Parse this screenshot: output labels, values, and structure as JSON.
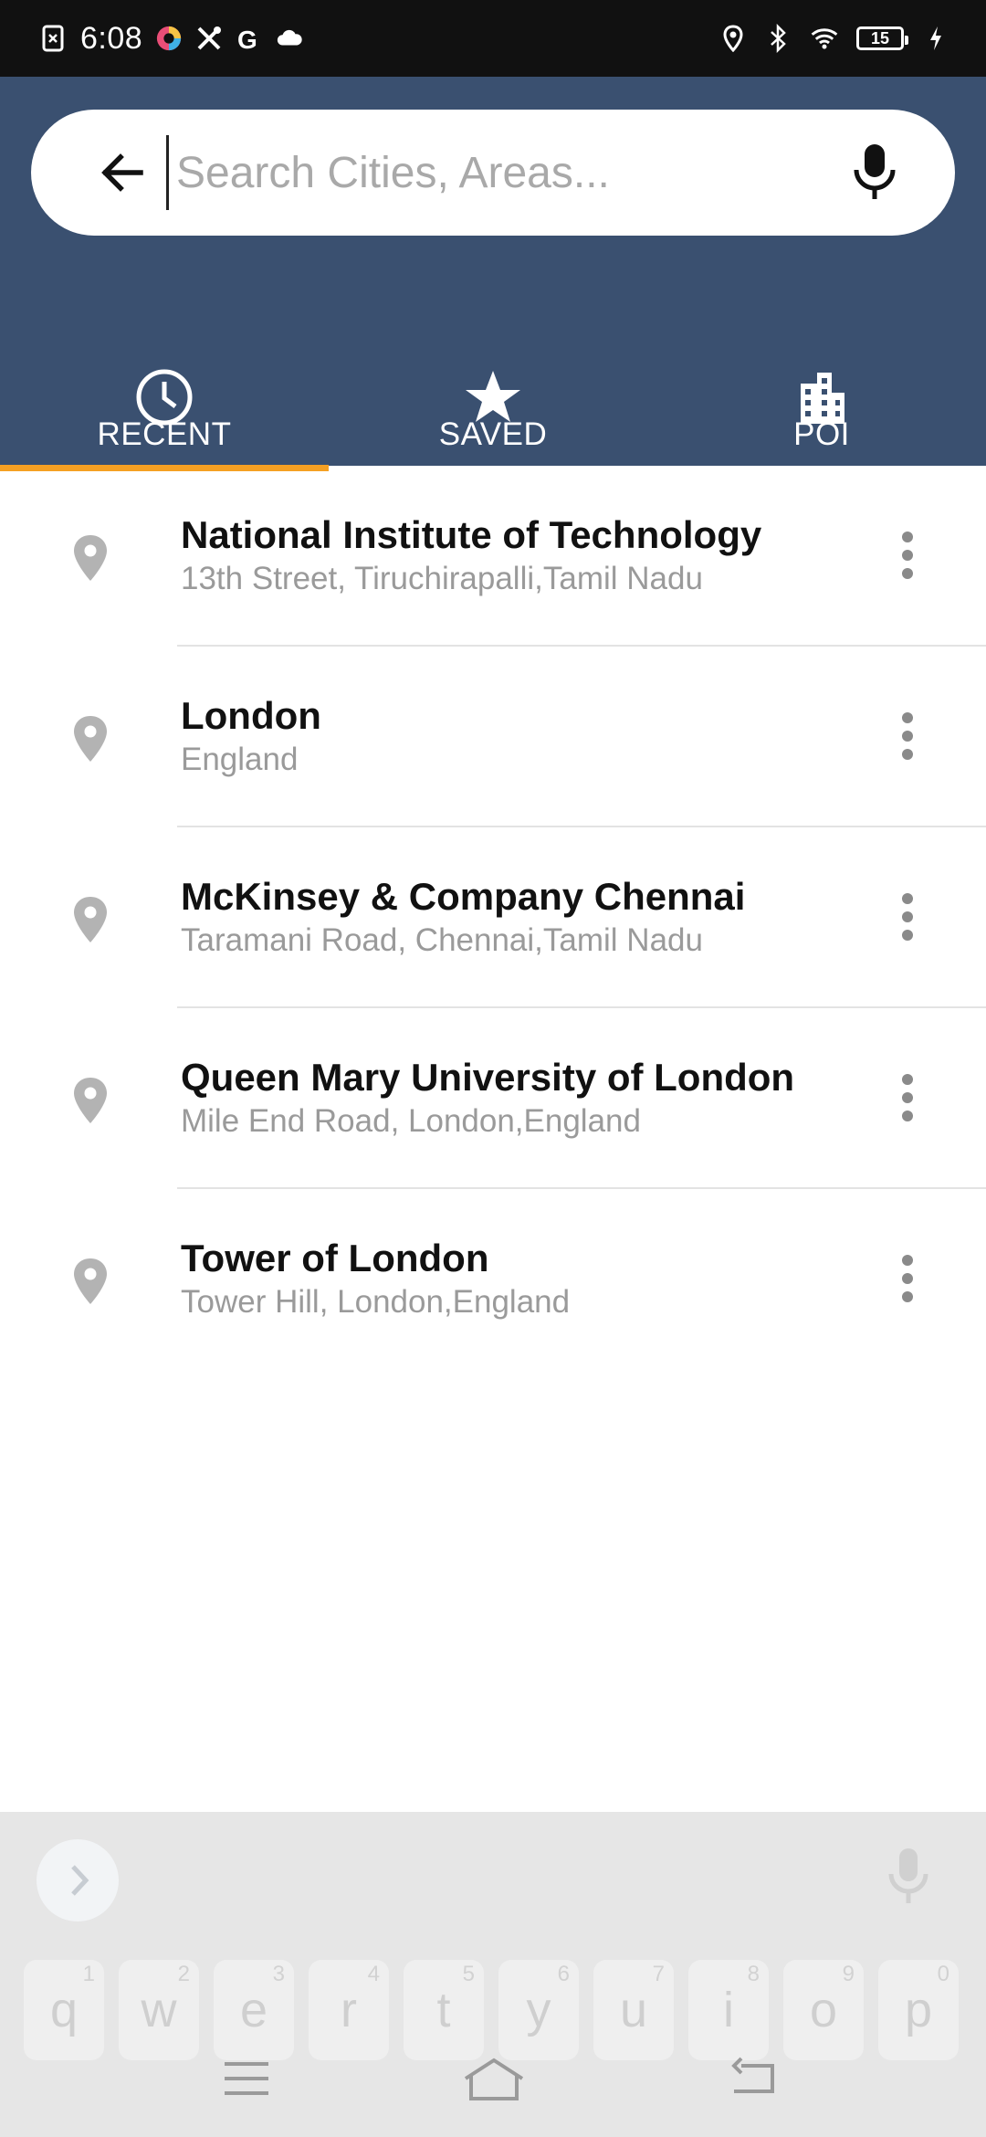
{
  "status_bar": {
    "time": "6:08",
    "battery_level": "15",
    "left_icons": [
      "screenshot-error-icon",
      "colorful-app-icon",
      "tools-icon",
      "google-icon",
      "cloud-icon"
    ],
    "right_icons": [
      "location-icon",
      "bluetooth-icon",
      "wifi-icon",
      "battery-icon",
      "charging-icon"
    ]
  },
  "search": {
    "placeholder": "Search Cities, Areas...",
    "value": ""
  },
  "tabs": [
    {
      "label": "RECENT",
      "icon": "clock-icon",
      "active": true
    },
    {
      "label": "SAVED",
      "icon": "star-icon",
      "active": false
    },
    {
      "label": "POI",
      "icon": "building-icon",
      "active": false
    }
  ],
  "recent_items": [
    {
      "title": "National Institute of Technology",
      "subtitle": "13th Street, Tiruchirapalli,Tamil Nadu"
    },
    {
      "title": "London",
      "subtitle": "England"
    },
    {
      "title": "McKinsey & Company Chennai",
      "subtitle": "Taramani Road, Chennai,Tamil Nadu"
    },
    {
      "title": "Queen Mary University of London",
      "subtitle": "Mile End Road, London,England"
    },
    {
      "title": "Tower of London",
      "subtitle": "Tower Hill, London,England"
    }
  ],
  "keyboard": {
    "keys": [
      {
        "letter": "q",
        "num": "1"
      },
      {
        "letter": "w",
        "num": "2"
      },
      {
        "letter": "e",
        "num": "3"
      },
      {
        "letter": "r",
        "num": "4"
      },
      {
        "letter": "t",
        "num": "5"
      },
      {
        "letter": "y",
        "num": "6"
      },
      {
        "letter": "u",
        "num": "7"
      },
      {
        "letter": "i",
        "num": "8"
      },
      {
        "letter": "o",
        "num": "9"
      },
      {
        "letter": "p",
        "num": "0"
      }
    ]
  },
  "colors": {
    "header_bg": "#3a5070",
    "tab_indicator": "#f5a023",
    "status_bar_bg": "#111111"
  }
}
